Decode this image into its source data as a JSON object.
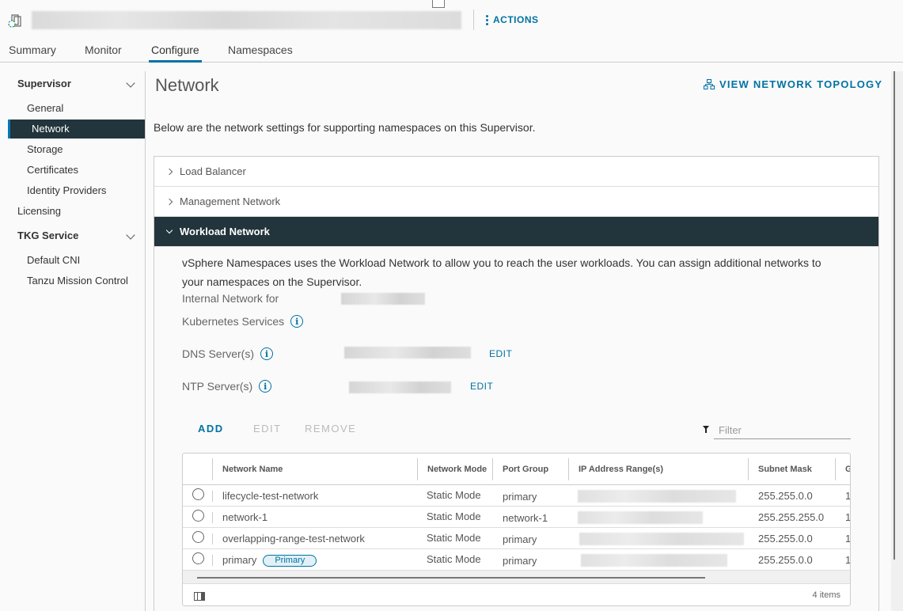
{
  "header": {
    "object_icon": "supervisor-cluster-icon",
    "object_title": "",
    "actions_label": "ACTIONS"
  },
  "tabs": [
    {
      "label": "Summary",
      "active": false
    },
    {
      "label": "Monitor",
      "active": false
    },
    {
      "label": "Configure",
      "active": true
    },
    {
      "label": "Namespaces",
      "active": false
    }
  ],
  "sidebar": {
    "groups": [
      {
        "label": "Supervisor",
        "expanded": true,
        "items": [
          "General",
          "Network",
          "Storage",
          "Certificates",
          "Identity Providers"
        ]
      },
      {
        "label": "Licensing"
      },
      {
        "label": "TKG Service",
        "expanded": true,
        "items": [
          "Default CNI",
          "Tanzu Mission Control"
        ]
      }
    ],
    "active_item": "Network"
  },
  "main": {
    "title": "Network",
    "topology_label": "VIEW NETWORK TOPOLOGY",
    "intro": "Below are the network settings for supporting namespaces on this Supervisor.",
    "accordions": [
      {
        "label": "Load Balancer",
        "expanded": false
      },
      {
        "label": "Management Network",
        "expanded": false
      },
      {
        "label": "Workload Network",
        "expanded": true
      }
    ]
  },
  "workload": {
    "description": "vSphere Namespaces uses the Workload Network to allow you to reach the user workloads. You can assign additional networks to your namespaces on the Supervisor.",
    "internal_network_label_1": "Internal Network for",
    "internal_network_label_2": "Kubernetes Services",
    "dns_label": "DNS Server(s)",
    "ntp_label": "NTP Server(s)",
    "edit_label": "EDIT",
    "toolbar": {
      "add": "ADD",
      "edit": "EDIT",
      "remove": "REMOVE"
    },
    "filter_placeholder": "Filter",
    "columns": [
      "Network Name",
      "Network Mode",
      "Port Group",
      "IP Address Range(s)",
      "Subnet Mask",
      "G"
    ],
    "rows": [
      {
        "name": "lifecycle-test-network",
        "badge": "",
        "mode": "Static Mode",
        "port_group": "primary",
        "subnet": "255.255.0.0",
        "gateway_partial": "1"
      },
      {
        "name": "network-1",
        "badge": "",
        "mode": "Static Mode",
        "port_group": "network-1",
        "subnet": "255.255.255.0",
        "gateway_partial": "1"
      },
      {
        "name": "overlapping-range-test-network",
        "badge": "",
        "mode": "Static Mode",
        "port_group": "primary",
        "subnet": "255.255.0.0",
        "gateway_partial": "1"
      },
      {
        "name": "primary",
        "badge": "Primary",
        "mode": "Static Mode",
        "port_group": "primary",
        "subnet": "255.255.0.0",
        "gateway_partial": "1"
      }
    ],
    "items_count": "4 items"
  }
}
